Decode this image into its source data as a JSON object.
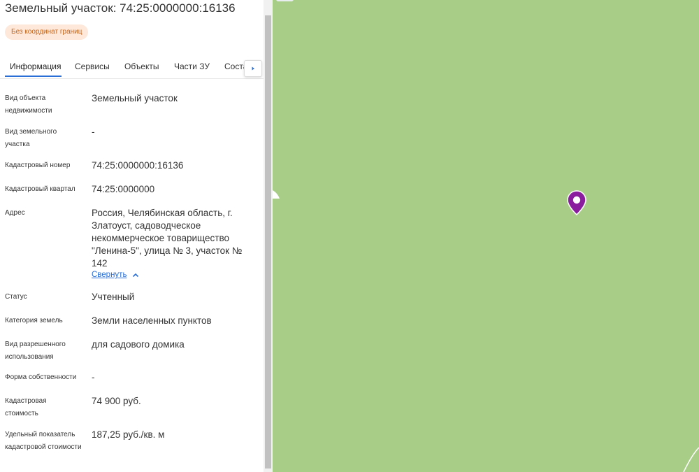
{
  "panel": {
    "title": "Земельный участок: 74:25:0000000:16136",
    "badge": "Без координат границ",
    "tabs": [
      "Информация",
      "Сервисы",
      "Объекты",
      "Части ЗУ",
      "Соста"
    ],
    "fields": [
      {
        "label": "Вид объекта недвижимости",
        "value": "Земельный участок"
      },
      {
        "label": "Вид земельного участка",
        "value": "-"
      },
      {
        "label": "Кадастровый номер",
        "value": "74:25:0000000:16136"
      },
      {
        "label": "Кадастровый квартал",
        "value": "74:25:0000000"
      },
      {
        "label": "Адрес",
        "value": "Россия, Челябинская область, г. Златоуст, садоводческое некоммерческое товарищество \"Ленина-5\", улица № 3, участок № 142"
      },
      {
        "label": "Статус",
        "value": "Учтенный"
      },
      {
        "label": "Категория земель",
        "value": "Земли населенных пунктов"
      },
      {
        "label": "Вид разрешенного использования",
        "value": "для садового домика"
      },
      {
        "label": "Форма собственности",
        "value": "-"
      },
      {
        "label": "Кадастровая стоимость",
        "value": "74 900 руб."
      },
      {
        "label": "Удельный показатель кадастровой стоимости",
        "value": "187,25 руб./кв. м"
      }
    ],
    "collapse_link": "Свернуть"
  },
  "colors": {
    "accent": "#2a6fd6",
    "badge_bg": "#fde8da",
    "badge_text": "#c5641a",
    "map_green": "#a8cd87",
    "pin": "#8a1c9e"
  },
  "icons": {
    "tabs_next": "chevron-right-icon",
    "collapse": "chevron-up-icon",
    "map_marker": "map-pin-icon"
  }
}
